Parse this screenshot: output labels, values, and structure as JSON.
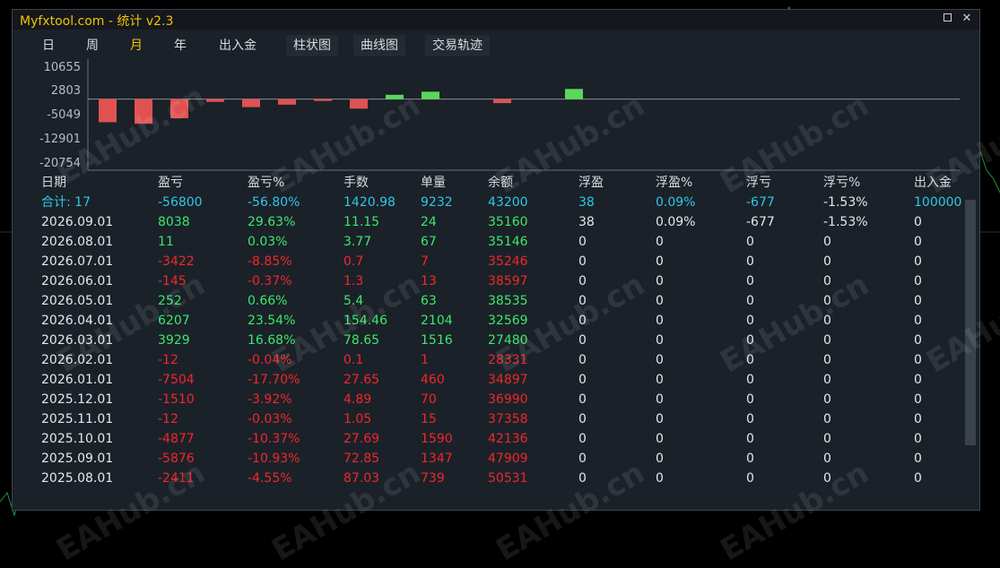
{
  "window": {
    "title": "Myfxtool.com - 统计  v2.3"
  },
  "controls": {
    "maximize_label": "",
    "close_label": "✕"
  },
  "tabs": [
    {
      "label": "日",
      "active": false
    },
    {
      "label": "周",
      "active": false
    },
    {
      "label": "月",
      "active": true
    },
    {
      "label": "年",
      "active": false
    },
    {
      "label": "出入金",
      "active": false
    },
    {
      "label": "柱状图",
      "active": false
    },
    {
      "label": "曲线图",
      "active": false
    },
    {
      "label": "交易轨迹",
      "active": false
    }
  ],
  "watermark": "EAHub.cn",
  "colors": {
    "title": "#f2c300",
    "positive": "#3be86a",
    "negative": "#f02828",
    "summary": "#2fc7e6",
    "bar_positive": "#5ad85a",
    "bar_negative": "#e05252"
  },
  "chart_data": {
    "type": "bar",
    "y_ticks": [
      "10655",
      "2803",
      "-5049",
      "-12901",
      "-20754"
    ],
    "ylim": [
      -20754,
      10655
    ],
    "values": [
      -7504,
      -7504,
      -6207,
      -700,
      -2400,
      -2000,
      -700,
      -3100,
      1510,
      2600,
      0,
      0,
      0,
      0,
      -1100,
      0,
      0,
      3300,
      0,
      0,
      0,
      0,
      0,
      0,
      0
    ],
    "bars": [
      {
        "value": -7504
      },
      {
        "value": -8000
      },
      {
        "value": -6207
      },
      {
        "value": -900
      },
      {
        "value": -2600
      },
      {
        "value": -1800
      },
      {
        "value": -600
      },
      {
        "value": -3100
      },
      {
        "value": 1400
      },
      {
        "value": 2400
      },
      {
        "value": -1300
      },
      {
        "value": 3300
      }
    ]
  },
  "table": {
    "headers": [
      "日期",
      "盈亏",
      "盈亏%",
      "手数",
      "单量",
      "余额",
      "浮盈",
      "浮盈%",
      "浮亏",
      "浮亏%",
      "出入金"
    ],
    "summary": [
      "合计: 17",
      "-56800",
      "-56.80%",
      "1420.98",
      "9232",
      "43200",
      "38",
      "0.09%",
      "-677",
      "-1.53%",
      "100000"
    ],
    "rows": [
      {
        "cells": [
          "2026.09.01",
          "8038",
          "29.63%",
          "11.15",
          "24",
          "35160",
          "38",
          "0.09%",
          "-677",
          "-1.53%",
          "0"
        ],
        "sign": "pos"
      },
      {
        "cells": [
          "2026.08.01",
          "11",
          "0.03%",
          "3.77",
          "67",
          "35146",
          "0",
          "0",
          "0",
          "0",
          "0"
        ],
        "sign": "pos"
      },
      {
        "cells": [
          "2026.07.01",
          "-3422",
          "-8.85%",
          "0.7",
          "7",
          "35246",
          "0",
          "0",
          "0",
          "0",
          "0"
        ],
        "sign": "neg"
      },
      {
        "cells": [
          "2026.06.01",
          "-145",
          "-0.37%",
          "1.3",
          "13",
          "38597",
          "0",
          "0",
          "0",
          "0",
          "0"
        ],
        "sign": "neg"
      },
      {
        "cells": [
          "2026.05.01",
          "252",
          "0.66%",
          "5.4",
          "63",
          "38535",
          "0",
          "0",
          "0",
          "0",
          "0"
        ],
        "sign": "pos"
      },
      {
        "cells": [
          "2026.04.01",
          "6207",
          "23.54%",
          "154.46",
          "2104",
          "32569",
          "0",
          "0",
          "0",
          "0",
          "0"
        ],
        "sign": "pos"
      },
      {
        "cells": [
          "2026.03.01",
          "3929",
          "16.68%",
          "78.65",
          "1516",
          "27480",
          "0",
          "0",
          "0",
          "0",
          "0"
        ],
        "sign": "pos"
      },
      {
        "cells": [
          "2026.02.01",
          "-12",
          "-0.04%",
          "0.1",
          "1",
          "28331",
          "0",
          "0",
          "0",
          "0",
          "0"
        ],
        "sign": "neg"
      },
      {
        "cells": [
          "2026.01.01",
          "-7504",
          "-17.70%",
          "27.65",
          "460",
          "34897",
          "0",
          "0",
          "0",
          "0",
          "0"
        ],
        "sign": "neg"
      },
      {
        "cells": [
          "2025.12.01",
          "-1510",
          "-3.92%",
          "4.89",
          "70",
          "36990",
          "0",
          "0",
          "0",
          "0",
          "0"
        ],
        "sign": "neg"
      },
      {
        "cells": [
          "2025.11.01",
          "-12",
          "-0.03%",
          "1.05",
          "15",
          "37358",
          "0",
          "0",
          "0",
          "0",
          "0"
        ],
        "sign": "neg"
      },
      {
        "cells": [
          "2025.10.01",
          "-4877",
          "-10.37%",
          "27.69",
          "1590",
          "42136",
          "0",
          "0",
          "0",
          "0",
          "0"
        ],
        "sign": "neg"
      },
      {
        "cells": [
          "2025.09.01",
          "-5876",
          "-10.93%",
          "72.85",
          "1347",
          "47909",
          "0",
          "0",
          "0",
          "0",
          "0"
        ],
        "sign": "neg"
      },
      {
        "cells": [
          "2025.08.01",
          "-2411",
          "-4.55%",
          "87.03",
          "739",
          "50531",
          "0",
          "0",
          "0",
          "0",
          "0"
        ],
        "sign": "neg"
      }
    ]
  }
}
